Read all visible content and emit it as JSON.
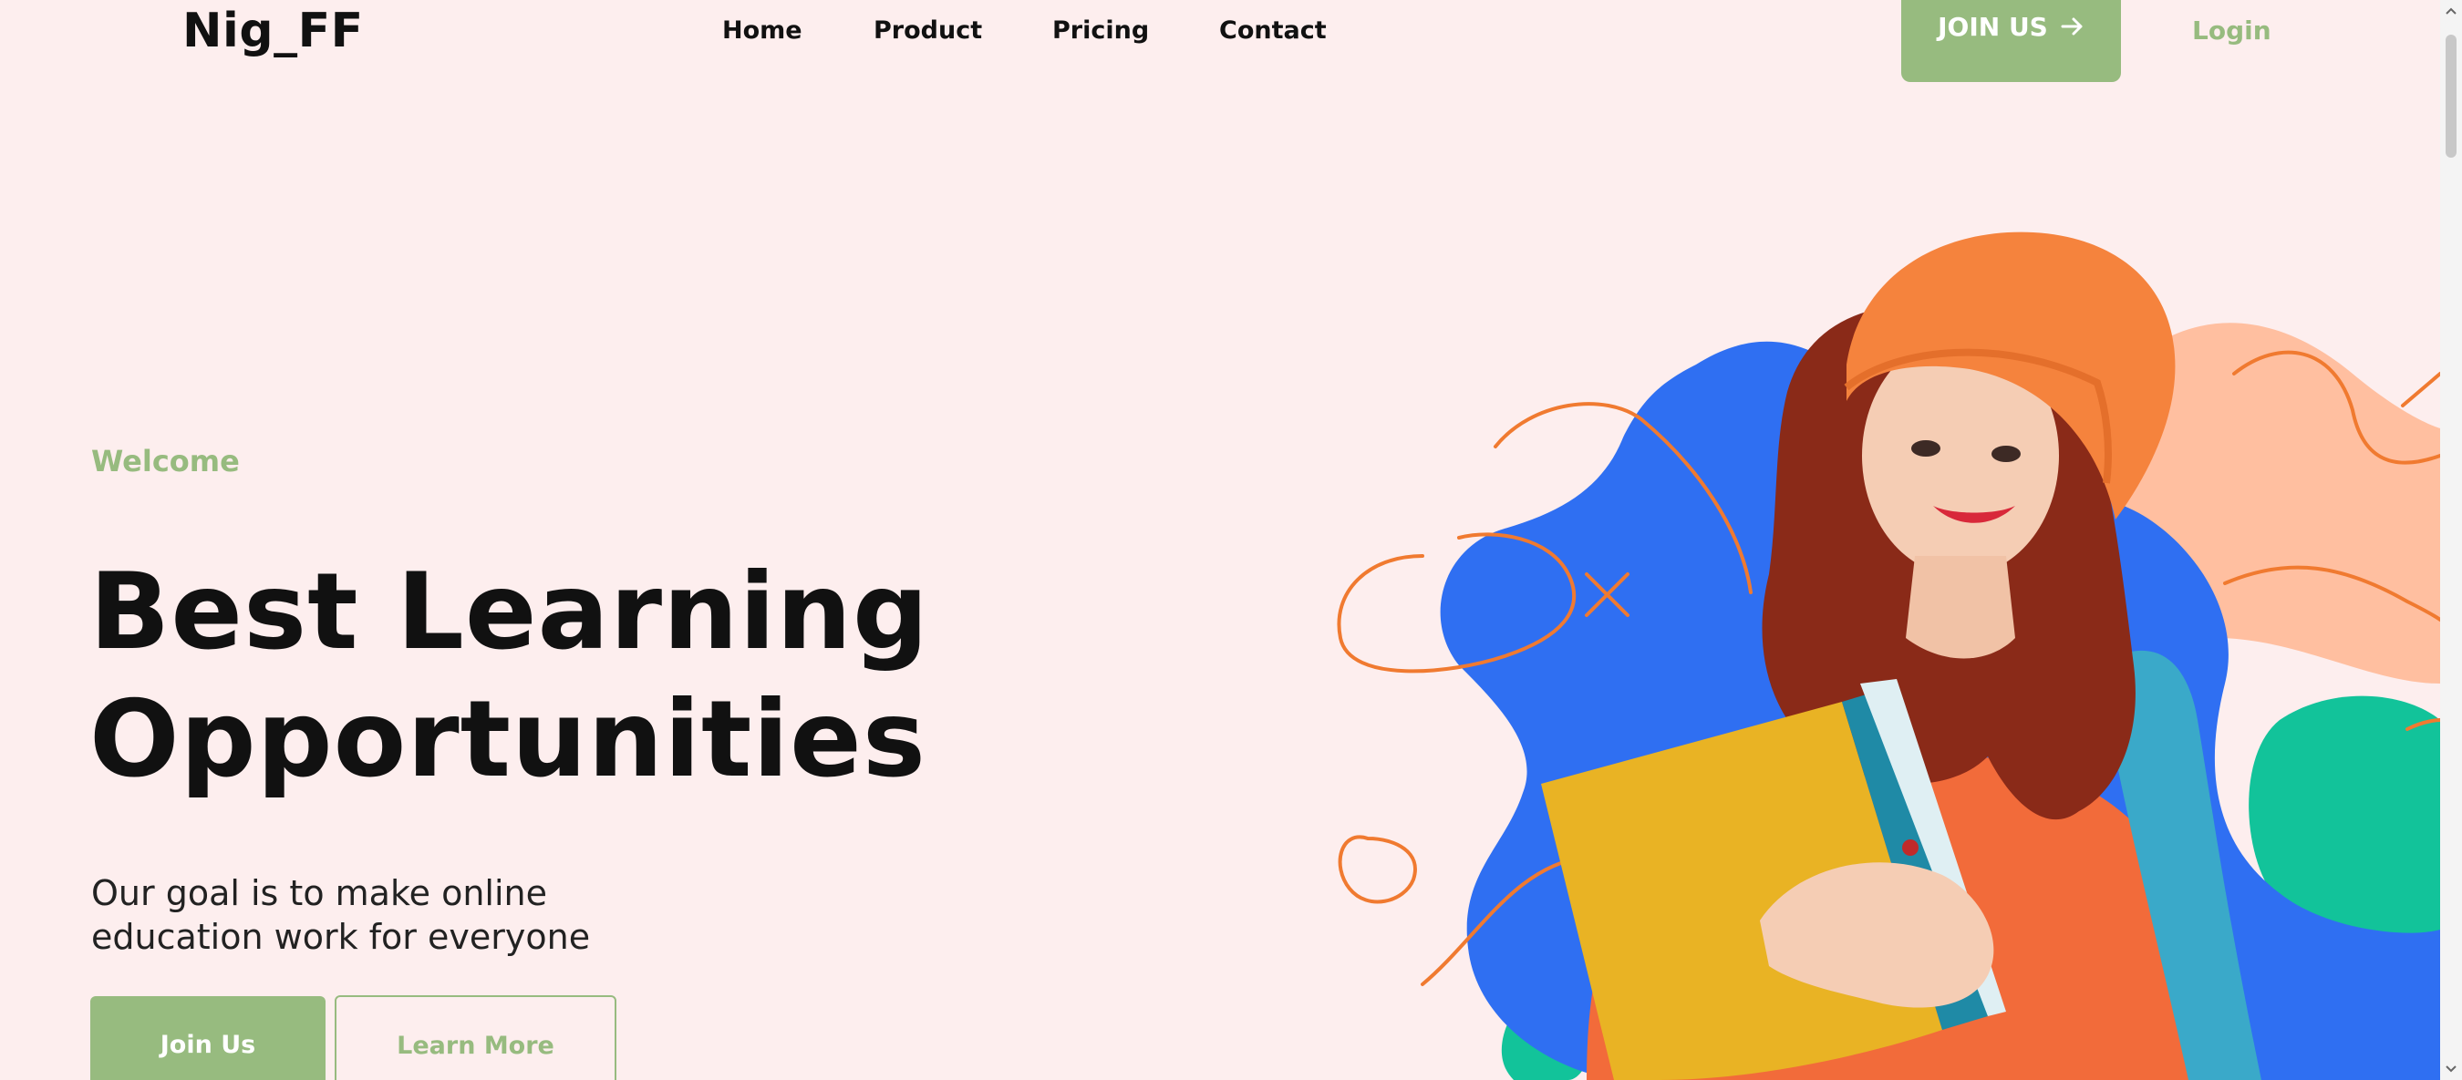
{
  "header": {
    "brand": "Nig_FF",
    "nav": [
      {
        "label": "Home"
      },
      {
        "label": "Product"
      },
      {
        "label": "Pricing"
      },
      {
        "label": "Contact"
      }
    ],
    "join_button": {
      "label": "JOIN US",
      "icon": "arrow-right-icon"
    },
    "login_label": "Login"
  },
  "hero": {
    "eyebrow": "Welcome",
    "headline_line1": "Best Learning",
    "headline_line2": "Opportunities",
    "subtext_line1": "Our goal is to make online",
    "subtext_line2": "education work for everyone",
    "primary_cta": "Join Us",
    "secondary_cta": "Learn More",
    "image": {
      "subject": "smiling student with orange beanie holding yellow folder",
      "icon": "student-photo"
    }
  },
  "colors": {
    "background": "#fdeeee",
    "accent_green": "#97bb7f",
    "text_dark": "#111111",
    "blob_blue": "#2f6ff2",
    "blob_peach": "#ffbfa0",
    "blob_teal": "#12c39a",
    "squiggle_orange": "#f07a30",
    "sweater_orange": "#f26b3a",
    "beanie_orange": "#f5833d",
    "folder_yellow": "#e9b324"
  }
}
